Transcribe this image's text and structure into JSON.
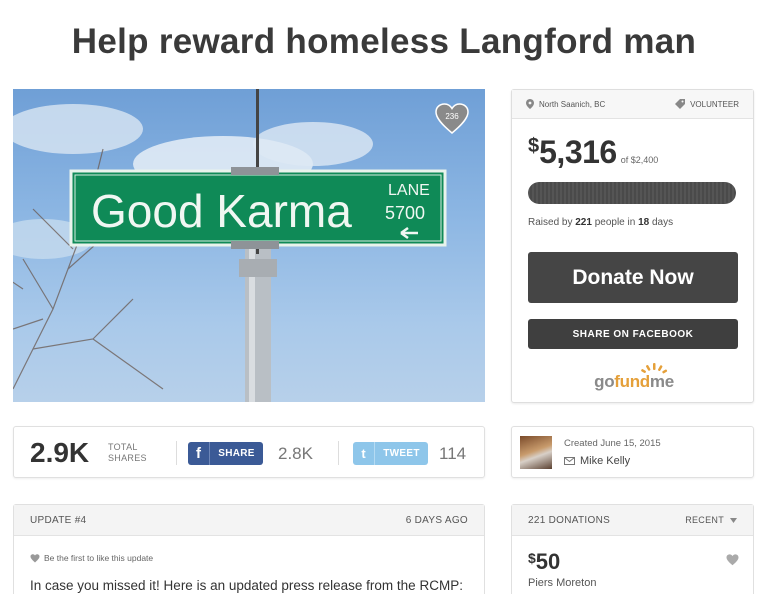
{
  "page": {
    "title": "Help reward homeless Langford man"
  },
  "hero": {
    "like_count": "236",
    "sign": {
      "name": "Good Karma",
      "suffix": "LANE",
      "number": "5700"
    }
  },
  "campaign": {
    "location": "North Saanich, BC",
    "category": "VOLUNTEER",
    "currency": "$",
    "raised": "5,316",
    "goal_text": "of $2,400",
    "progress": 1.0,
    "raised_by_prefix": "Raised by",
    "raised_by_people": "221",
    "raised_by_mid": "people in",
    "raised_by_days": "18",
    "raised_by_suffix": "days",
    "donate_label": "Donate Now",
    "share_facebook_label": "SHARE ON FACEBOOK",
    "logo": {
      "go": "go",
      "fund": "fund",
      "me": "me"
    }
  },
  "share": {
    "total": "2.9K",
    "total_label_1": "TOTAL",
    "total_label_2": "SHARES",
    "facebook_label": "SHARE",
    "facebook_count": "2.8K",
    "twitter_label": "TWEET",
    "twitter_count": "114"
  },
  "organizer": {
    "created": "Created June 15, 2015",
    "name": "Mike Kelly"
  },
  "update": {
    "header": "UPDATE #4",
    "age": "6 DAYS AGO",
    "like_prompt": "Be the first to like this update",
    "text": "In case you missed it! Here is an updated press release from the RCMP:"
  },
  "donations": {
    "header": "221 DONATIONS",
    "sort": "RECENT",
    "items": [
      {
        "currency": "$",
        "amount": "50",
        "name": "Piers Moreton"
      }
    ]
  },
  "colors": {
    "facebook": "#3b5a96",
    "twitter": "#8ec6ea",
    "button_dark": "#454545",
    "logo_orange": "#e5a03a"
  }
}
